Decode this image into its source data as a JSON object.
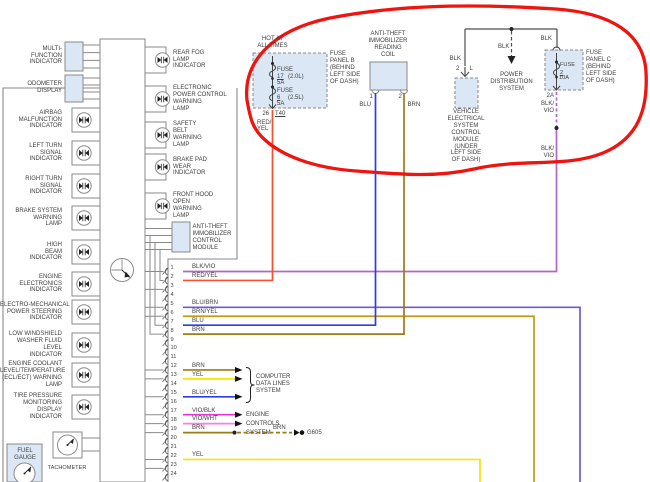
{
  "colors": {
    "redyel": "#f8502a",
    "yel": "#f2e606",
    "brn": "#9e7b16",
    "brnyel": "#bf9d10",
    "blu": "#2a3cec",
    "blubrn": "#6e5ad8",
    "bluyel": "#2a3cec",
    "blkvio": "#b366c9",
    "vioblk": "#e633d6",
    "viowht": "#fb7ce8",
    "blk": "#4d4d4d",
    "structure": "#8a8a8a",
    "text": "#3e3e3e",
    "panel_fill": "#dbe7f4",
    "highlight": "#ee1510"
  },
  "power": {
    "hot_at_all_times": "HOT AT\nALL TIMES",
    "fuse_panel_b": {
      "label": "FUSE\nPANEL B\n(BEHIND\nLEFT SIDE\nOF DASH)",
      "fuses": [
        {
          "name": "FUSE",
          "num": "17",
          "amp": "5A",
          "note": "(2.0L)"
        },
        {
          "name": "FUSE",
          "num": "6",
          "amp": "5A",
          "note": "(2.5L)"
        }
      ],
      "terminal_pin": "26",
      "terminal_id": "T40",
      "wire": "RED/\nYEL"
    },
    "fuse_panel_c": {
      "label": "FUSE\nPANEL C\n(BEHIND\nLEFT SIDE\nOF DASH)",
      "fuse": {
        "name": "FUSE",
        "num": "2",
        "amp": "10A"
      },
      "in_wire": "BLK",
      "terminal": "2A",
      "wire": "BLK/\nVIO",
      "wire2": "BLK/\nVIO"
    },
    "power_distribution": {
      "label": "POWER\nDISTRIBUTION\nSYSTEM",
      "wire": "BLK"
    },
    "vescm": {
      "label": "VEHICLE\nELECTRICAL\nSYSTEM\nCONTROL\nMODULE\n(UNDER\nLEFT SIDE\nOF DASH)",
      "pin": "2",
      "pin_id": "L",
      "wire": "BLK"
    }
  },
  "reading_coil": {
    "label": "ANTI-THEFT\nIMMOBILIZER\nREADING\nCOIL",
    "pins": [
      {
        "n": "1",
        "wire": "BLU"
      },
      {
        "n": "2",
        "wire": "BRN"
      }
    ]
  },
  "cluster": {
    "left_indicators": [
      {
        "label": "MULTI-\nFUNCTION\nINDICATOR",
        "kind": "display"
      },
      {
        "label": "ODOMETER\nDISPLAY",
        "kind": "display"
      },
      {
        "label": "AIRBAG\nMALFUNCTION\nINDICATOR",
        "kind": "lamp"
      },
      {
        "label": "LEFT TURN\nSIGNAL\nINDICATOR",
        "kind": "lamp"
      },
      {
        "label": "RIGHT TURN\nSIGNAL\nINDICATOR",
        "kind": "lamp"
      },
      {
        "label": "BRAKE SYSTEM\nWARNING\nLAMP",
        "kind": "lamp"
      },
      {
        "label": "HIGH\nBEAM\nINDICATOR",
        "kind": "lamp"
      },
      {
        "label": "ENGINE\nELECTRONICS\nINDICATOR",
        "kind": "lamp"
      },
      {
        "label": "ELECTRO-MECHANICAL\nPOWER STEERING\nINDICATOR",
        "kind": "lamp"
      },
      {
        "label": "LOW WINDSHIELD\nWASHER FLUID\nLEVEL\nINDICATOR",
        "kind": "lamp"
      },
      {
        "label": "ENGINE COOLANT\nLEVEL/TEMPERATURE\n(ECL/ECT) WARNING\nLAMP",
        "kind": "lamp"
      },
      {
        "label": "TIRE PRESSURE\nMONITORING\nDISPLAY\nINDICATOR",
        "kind": "lamp"
      }
    ],
    "right_indicators": [
      {
        "label": "REAR FOG\nLAMP\nINDICATOR"
      },
      {
        "label": "ELECTRONIC\nPOWER CONTROL\nWARNING\nLAMP"
      },
      {
        "label": "SAFETY\nBELT\nWARNING\nLAMP"
      },
      {
        "label": "BRAKE PAD\nWEAR\nINDICATOR"
      },
      {
        "label": "FRONT HOOD\nOPEN\nWARNING\nLAMP"
      }
    ],
    "immobilizer_module": {
      "label": "ANTI-THEFT\nIMMOBILIZER\nCONTROL\nMODULE"
    },
    "fuel_gauge": {
      "label": "FUEL\nGAUGE"
    },
    "tachometer": {
      "label": "TACHOMETER"
    }
  },
  "connector": {
    "pins": [
      {
        "n": "1",
        "wire": "BLK/VIO",
        "color": "blkvio"
      },
      {
        "n": "2",
        "wire": "RED/YEL",
        "color": "redyel"
      },
      {
        "n": "3",
        "wire": "",
        "color": ""
      },
      {
        "n": "4",
        "wire": "",
        "color": ""
      },
      {
        "n": "5",
        "wire": "BLU/BRN",
        "color": "blubrn"
      },
      {
        "n": "6",
        "wire": "BRN/YEL",
        "color": "brnyel"
      },
      {
        "n": "7",
        "wire": "BLU",
        "color": "blu"
      },
      {
        "n": "8",
        "wire": "BRN",
        "color": "brn"
      },
      {
        "n": "9",
        "wire": "",
        "color": ""
      },
      {
        "n": "10",
        "wire": "",
        "color": ""
      },
      {
        "n": "11",
        "wire": "",
        "color": ""
      },
      {
        "n": "12",
        "wire": "BRN",
        "color": "brn"
      },
      {
        "n": "13",
        "wire": "YEL",
        "color": "yel"
      },
      {
        "n": "14",
        "wire": "",
        "color": ""
      },
      {
        "n": "15",
        "wire": "BLU/YEL",
        "color": "bluyel"
      },
      {
        "n": "16",
        "wire": "",
        "color": ""
      },
      {
        "n": "17",
        "wire": "VIO/BLK",
        "color": "vioblk"
      },
      {
        "n": "18",
        "wire": "VIO/WHT",
        "color": "viowht"
      },
      {
        "n": "19",
        "wire": "BRN",
        "color": "brn"
      },
      {
        "n": "20",
        "wire": "",
        "color": ""
      },
      {
        "n": "21",
        "wire": "",
        "color": ""
      },
      {
        "n": "22",
        "wire": "YEL",
        "color": "yel"
      },
      {
        "n": "23",
        "wire": "",
        "color": ""
      },
      {
        "n": "24",
        "wire": "",
        "color": ""
      }
    ]
  },
  "systems": {
    "computer_data_lines": "COMPUTER\nDATA LINES\nSYSTEM",
    "engine_controls": "ENGINE\nCONTROLS\nSYSTEM",
    "ground": {
      "wire": "BRN",
      "id": "G605"
    }
  }
}
